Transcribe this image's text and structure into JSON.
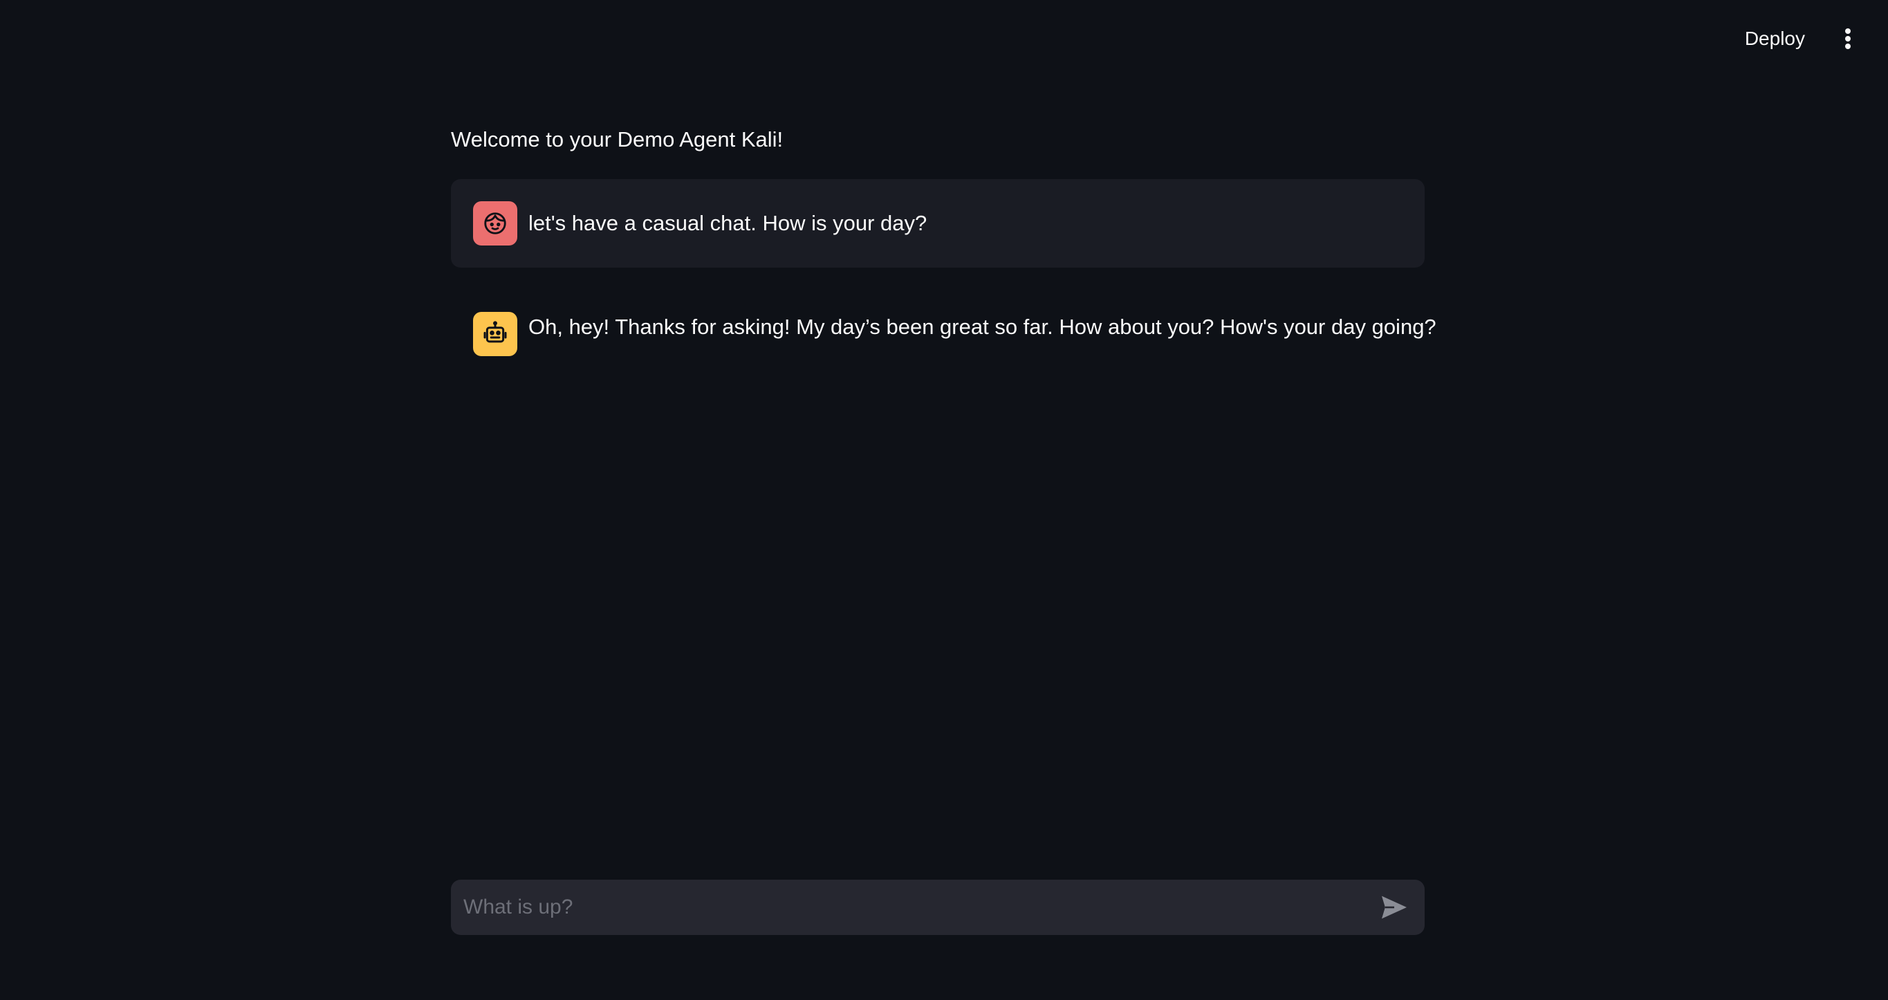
{
  "header": {
    "deploy_label": "Deploy",
    "menu_icon": "more-vertical-icon"
  },
  "main": {
    "welcome": "Welcome to your Demo Agent Kali!",
    "messages": [
      {
        "role": "user",
        "avatar_icon": "user-face-icon",
        "avatar_color": "#ec6f6f",
        "text": "let's have a casual chat. How is your day?"
      },
      {
        "role": "assistant",
        "avatar_icon": "robot-icon",
        "avatar_color": "#fdc44e",
        "text": "Oh, hey! Thanks for asking! My day’s been great so far. How about you? How's your day going?"
      }
    ]
  },
  "chat_input": {
    "placeholder": "What is up?",
    "value": "",
    "send_icon": "send-icon"
  },
  "colors": {
    "background": "#0e1117",
    "user_message_bg": "#1a1c24",
    "input_bg": "#262730",
    "text": "#fafafa"
  }
}
